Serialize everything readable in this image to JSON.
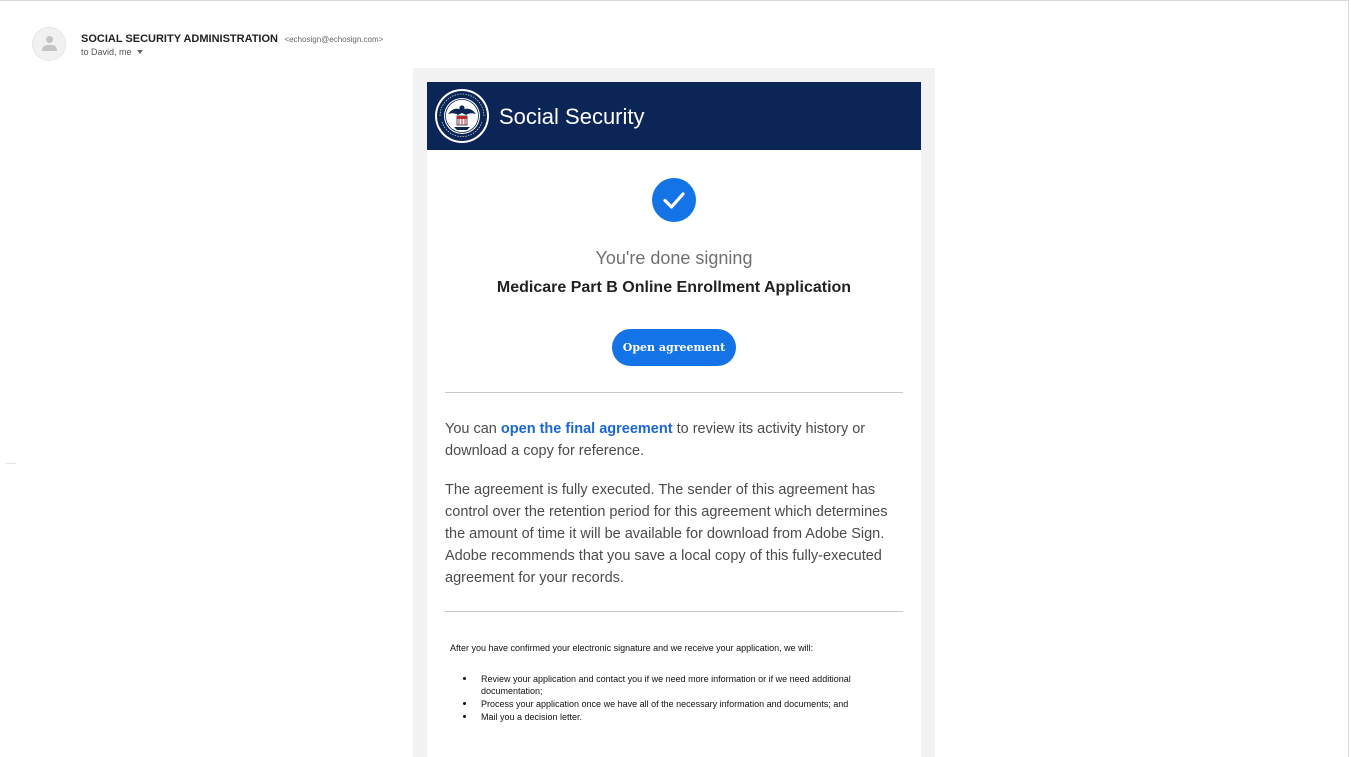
{
  "email": {
    "sender_name": "SOCIAL SECURITY ADMINISTRATION",
    "sender_email": "<echosign@echosign.com>",
    "recipients": "to David, me"
  },
  "banner": {
    "title": "Social Security",
    "background": "#0b2656"
  },
  "status": {
    "done_text": "You're done signing",
    "document_title": "Medicare Part B Online Enrollment Application",
    "accent": "#1473e6"
  },
  "button": {
    "open_label": "Open agreement"
  },
  "body": {
    "p1_prefix": "You can",
    "p1_link": "open the final agreement",
    "p1_suffix": "to review its activity history or download a copy for reference.",
    "p2": "The agreement is fully executed. The sender of this agreement has control over the retention period for this agreement which determines the amount of time it will be available for download from Adobe Sign. Adobe recommends that you save a local copy of this fully-executed agreement for your records."
  },
  "next_steps": {
    "heading": "After you have confirmed your electronic signature and we receive your application, we will:",
    "items": [
      "Review your application and contact you if we need more information or if we need additional documentation;",
      "Process your application once we have all of the necessary information and documents; and",
      "Mail you a decision letter."
    ]
  }
}
